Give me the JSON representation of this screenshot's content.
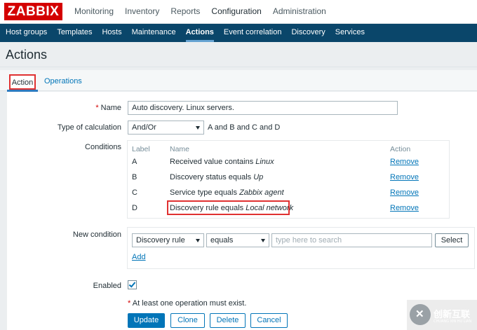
{
  "brand": {
    "logo_text": "ZABBIX"
  },
  "main_nav": [
    {
      "label": "Monitoring"
    },
    {
      "label": "Inventory"
    },
    {
      "label": "Reports"
    },
    {
      "label": "Configuration",
      "active": true
    },
    {
      "label": "Administration"
    }
  ],
  "sub_nav": [
    {
      "label": "Host groups"
    },
    {
      "label": "Templates"
    },
    {
      "label": "Hosts"
    },
    {
      "label": "Maintenance"
    },
    {
      "label": "Actions",
      "active": true
    },
    {
      "label": "Event correlation"
    },
    {
      "label": "Discovery"
    },
    {
      "label": "Services"
    }
  ],
  "page": {
    "title": "Actions"
  },
  "tabs": [
    {
      "label": "Action",
      "active": true
    },
    {
      "label": "Operations"
    }
  ],
  "form": {
    "name_label": "Name",
    "name_required_mark": "*",
    "name_value": "Auto discovery. Linux servers.",
    "calc_label": "Type of calculation",
    "calc_value": "And/Or",
    "calc_formula": "A and B and C and D",
    "conditions_label": "Conditions",
    "conditions_headers": {
      "label": "Label",
      "name": "Name",
      "action": "Action"
    },
    "conditions": [
      {
        "label": "A",
        "name_prefix": "Received value contains ",
        "name_value": "Linux",
        "action": "Remove"
      },
      {
        "label": "B",
        "name_prefix": "Discovery status equals ",
        "name_value": "Up",
        "action": "Remove"
      },
      {
        "label": "C",
        "name_prefix": "Service type equals ",
        "name_value": "Zabbix agent",
        "action": "Remove"
      },
      {
        "label": "D",
        "name_prefix": "Discovery rule equals ",
        "name_value": "Local network",
        "action": "Remove"
      }
    ],
    "new_condition_label": "New condition",
    "new_condition": {
      "type_value": "Discovery rule",
      "operator_value": "equals",
      "search_placeholder": "type here to search",
      "select_label": "Select",
      "add_label": "Add"
    },
    "enabled_label": "Enabled",
    "enabled_checked": true,
    "warning_mark": "*",
    "warning_text": " At least one operation must exist.",
    "buttons": {
      "update": "Update",
      "clone": "Clone",
      "delete": "Delete",
      "cancel": "Cancel"
    }
  },
  "watermark": {
    "title": "创新互联",
    "subtitle": "CHUANG XIN HU LIAN"
  },
  "colors": {
    "brand_red": "#d40000",
    "subnav_bg": "#0a466a",
    "link_blue": "#0275b8",
    "highlight_red": "#e03131"
  }
}
